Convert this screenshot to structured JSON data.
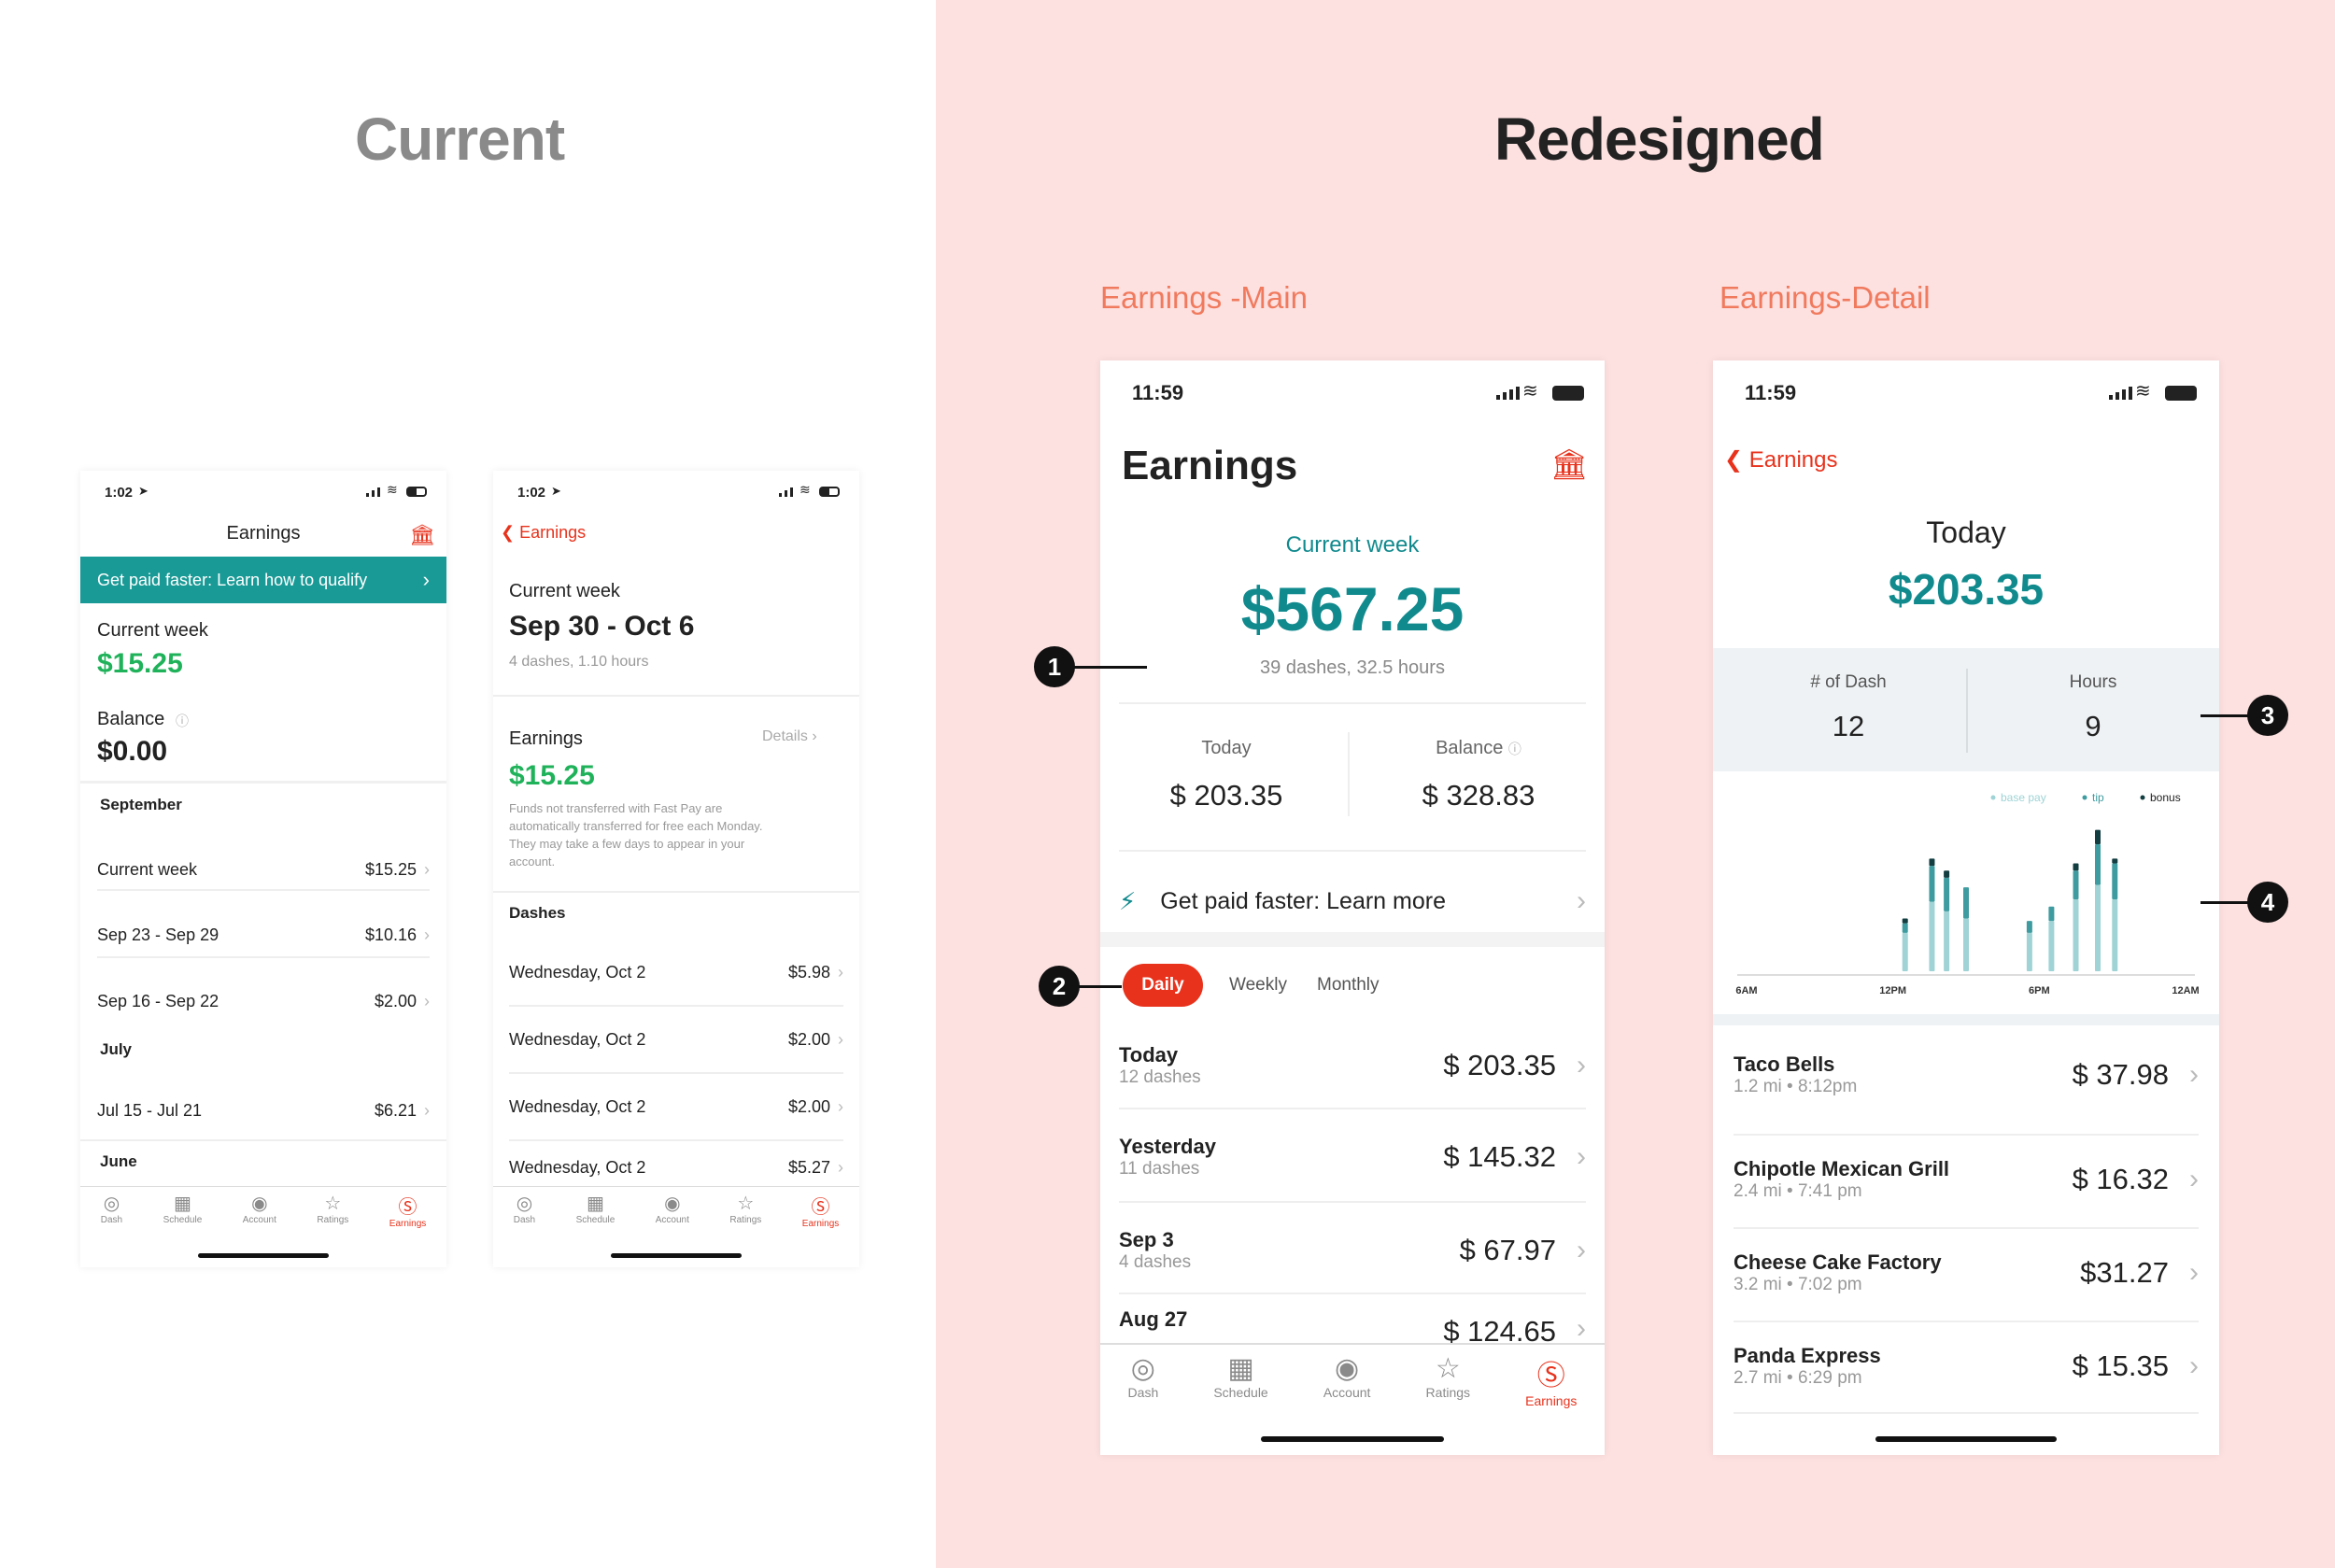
{
  "headings": {
    "current": "Current",
    "redesigned": "Redesigned",
    "main_label": "Earnings -Main",
    "detail_label": "Earnings-Detail"
  },
  "colors": {
    "accent_red": "#e8321c",
    "teal": "#118a8e",
    "green": "#20b25a",
    "pink_bg": "#fde0e0",
    "sub_label": "#f07a5d"
  },
  "status_bar": {
    "time_old": "1:02",
    "time_new": "11:59"
  },
  "tabs": [
    {
      "label": "Dash",
      "icon": "compass-icon"
    },
    {
      "label": "Schedule",
      "icon": "calendar-icon"
    },
    {
      "label": "Account",
      "icon": "account-icon"
    },
    {
      "label": "Ratings",
      "icon": "star-icon"
    },
    {
      "label": "Earnings",
      "icon": "dollar-icon"
    }
  ],
  "current1": {
    "title": "Earnings",
    "banner": "Get paid faster: Learn how to qualify",
    "week_label": "Current week",
    "week_amount": "$15.25",
    "balance_label": "Balance",
    "balance_amount": "$0.00",
    "groups": [
      {
        "label": "September",
        "rows": [
          {
            "label": "Current week",
            "amount": "$15.25"
          },
          {
            "label": "Sep 23 - Sep 29",
            "amount": "$10.16"
          },
          {
            "label": "Sep 16 - Sep 22",
            "amount": "$2.00"
          }
        ]
      },
      {
        "label": "July",
        "rows": [
          {
            "label": "Jul 15 - Jul 21",
            "amount": "$6.21"
          }
        ]
      },
      {
        "label": "June",
        "rows": []
      }
    ]
  },
  "current2": {
    "back": "Earnings",
    "week_label": "Current week",
    "range": "Sep 30 - Oct 6",
    "stats": "4 dashes, 1.10 hours",
    "earnings_label": "Earnings",
    "details": "Details",
    "amount": "$15.25",
    "note": "Funds not transferred with Fast Pay are automatically transferred for free each Monday.  They may take a few days to appear in your account.",
    "dashes_label": "Dashes",
    "dashes": [
      {
        "label": "Wednesday, Oct 2",
        "amount": "$5.98"
      },
      {
        "label": "Wednesday, Oct 2",
        "amount": "$2.00"
      },
      {
        "label": "Wednesday, Oct 2",
        "amount": "$2.00"
      },
      {
        "label": "Wednesday, Oct 2",
        "amount": "$5.27"
      }
    ]
  },
  "main": {
    "title": "Earnings",
    "week_label": "Current week",
    "total": "$567.25",
    "stats": "39 dashes, 32.5 hours",
    "today_label": "Today",
    "today_amount": "$ 203.35",
    "balance_label": "Balance",
    "balance_amount": "$ 328.83",
    "fastpay": "Get paid faster: Learn more",
    "periods": [
      "Daily",
      "Weekly",
      "Monthly"
    ],
    "days": [
      {
        "label": "Today",
        "sub": "12 dashes",
        "amount": "$ 203.35"
      },
      {
        "label": "Yesterday",
        "sub": "11 dashes",
        "amount": "$ 145.32"
      },
      {
        "label": "Sep 3",
        "sub": "4 dashes",
        "amount": "$ 67.97"
      },
      {
        "label": "Aug 27",
        "sub": "",
        "amount": "$ 124.65"
      }
    ]
  },
  "detail": {
    "back": "Earnings",
    "day": "Today",
    "amount": "$203.35",
    "dash_label": "# of Dash",
    "dash_count": "12",
    "hours_label": "Hours",
    "hours_count": "9",
    "orders": [
      {
        "name": "Taco Bells",
        "sub": "1.2 mi • 8:12pm",
        "amount": "$ 37.98"
      },
      {
        "name": "Chipotle Mexican Grill",
        "sub": "2.4 mi • 7:41 pm",
        "amount": "$ 16.32"
      },
      {
        "name": "Cheese Cake Factory",
        "sub": "3.2 mi • 7:02 pm",
        "amount": "$31.27"
      },
      {
        "name": "Panda Express",
        "sub": "2.7 mi • 6:29 pm",
        "amount": "$ 15.35"
      }
    ]
  },
  "annotations": [
    "1",
    "2",
    "3",
    "4"
  ],
  "chart_data": {
    "type": "bar",
    "stacked": true,
    "x_ticks": [
      "6AM",
      "12PM",
      "6PM",
      "12AM"
    ],
    "x_hours": [
      12.5,
      13.6,
      14.2,
      15.0,
      17.6,
      18.5,
      19.5,
      20.4,
      21.1
    ],
    "series": [
      {
        "name": "base pay",
        "color": "#9fd3d5",
        "values": [
          16,
          29,
          25,
          22,
          16,
          21,
          30,
          36,
          30
        ]
      },
      {
        "name": "tip",
        "color": "#3e9ca0",
        "values": [
          4,
          15,
          14,
          13,
          5,
          6,
          12,
          17,
          15
        ]
      },
      {
        "name": "bonus",
        "color": "#123d41",
        "values": [
          2,
          3,
          3,
          0,
          0,
          0,
          3,
          6,
          2
        ]
      }
    ],
    "xlim": [
      6,
      24
    ],
    "ylim": [
      0,
      60
    ],
    "legend": "top-right",
    "grid": false
  }
}
